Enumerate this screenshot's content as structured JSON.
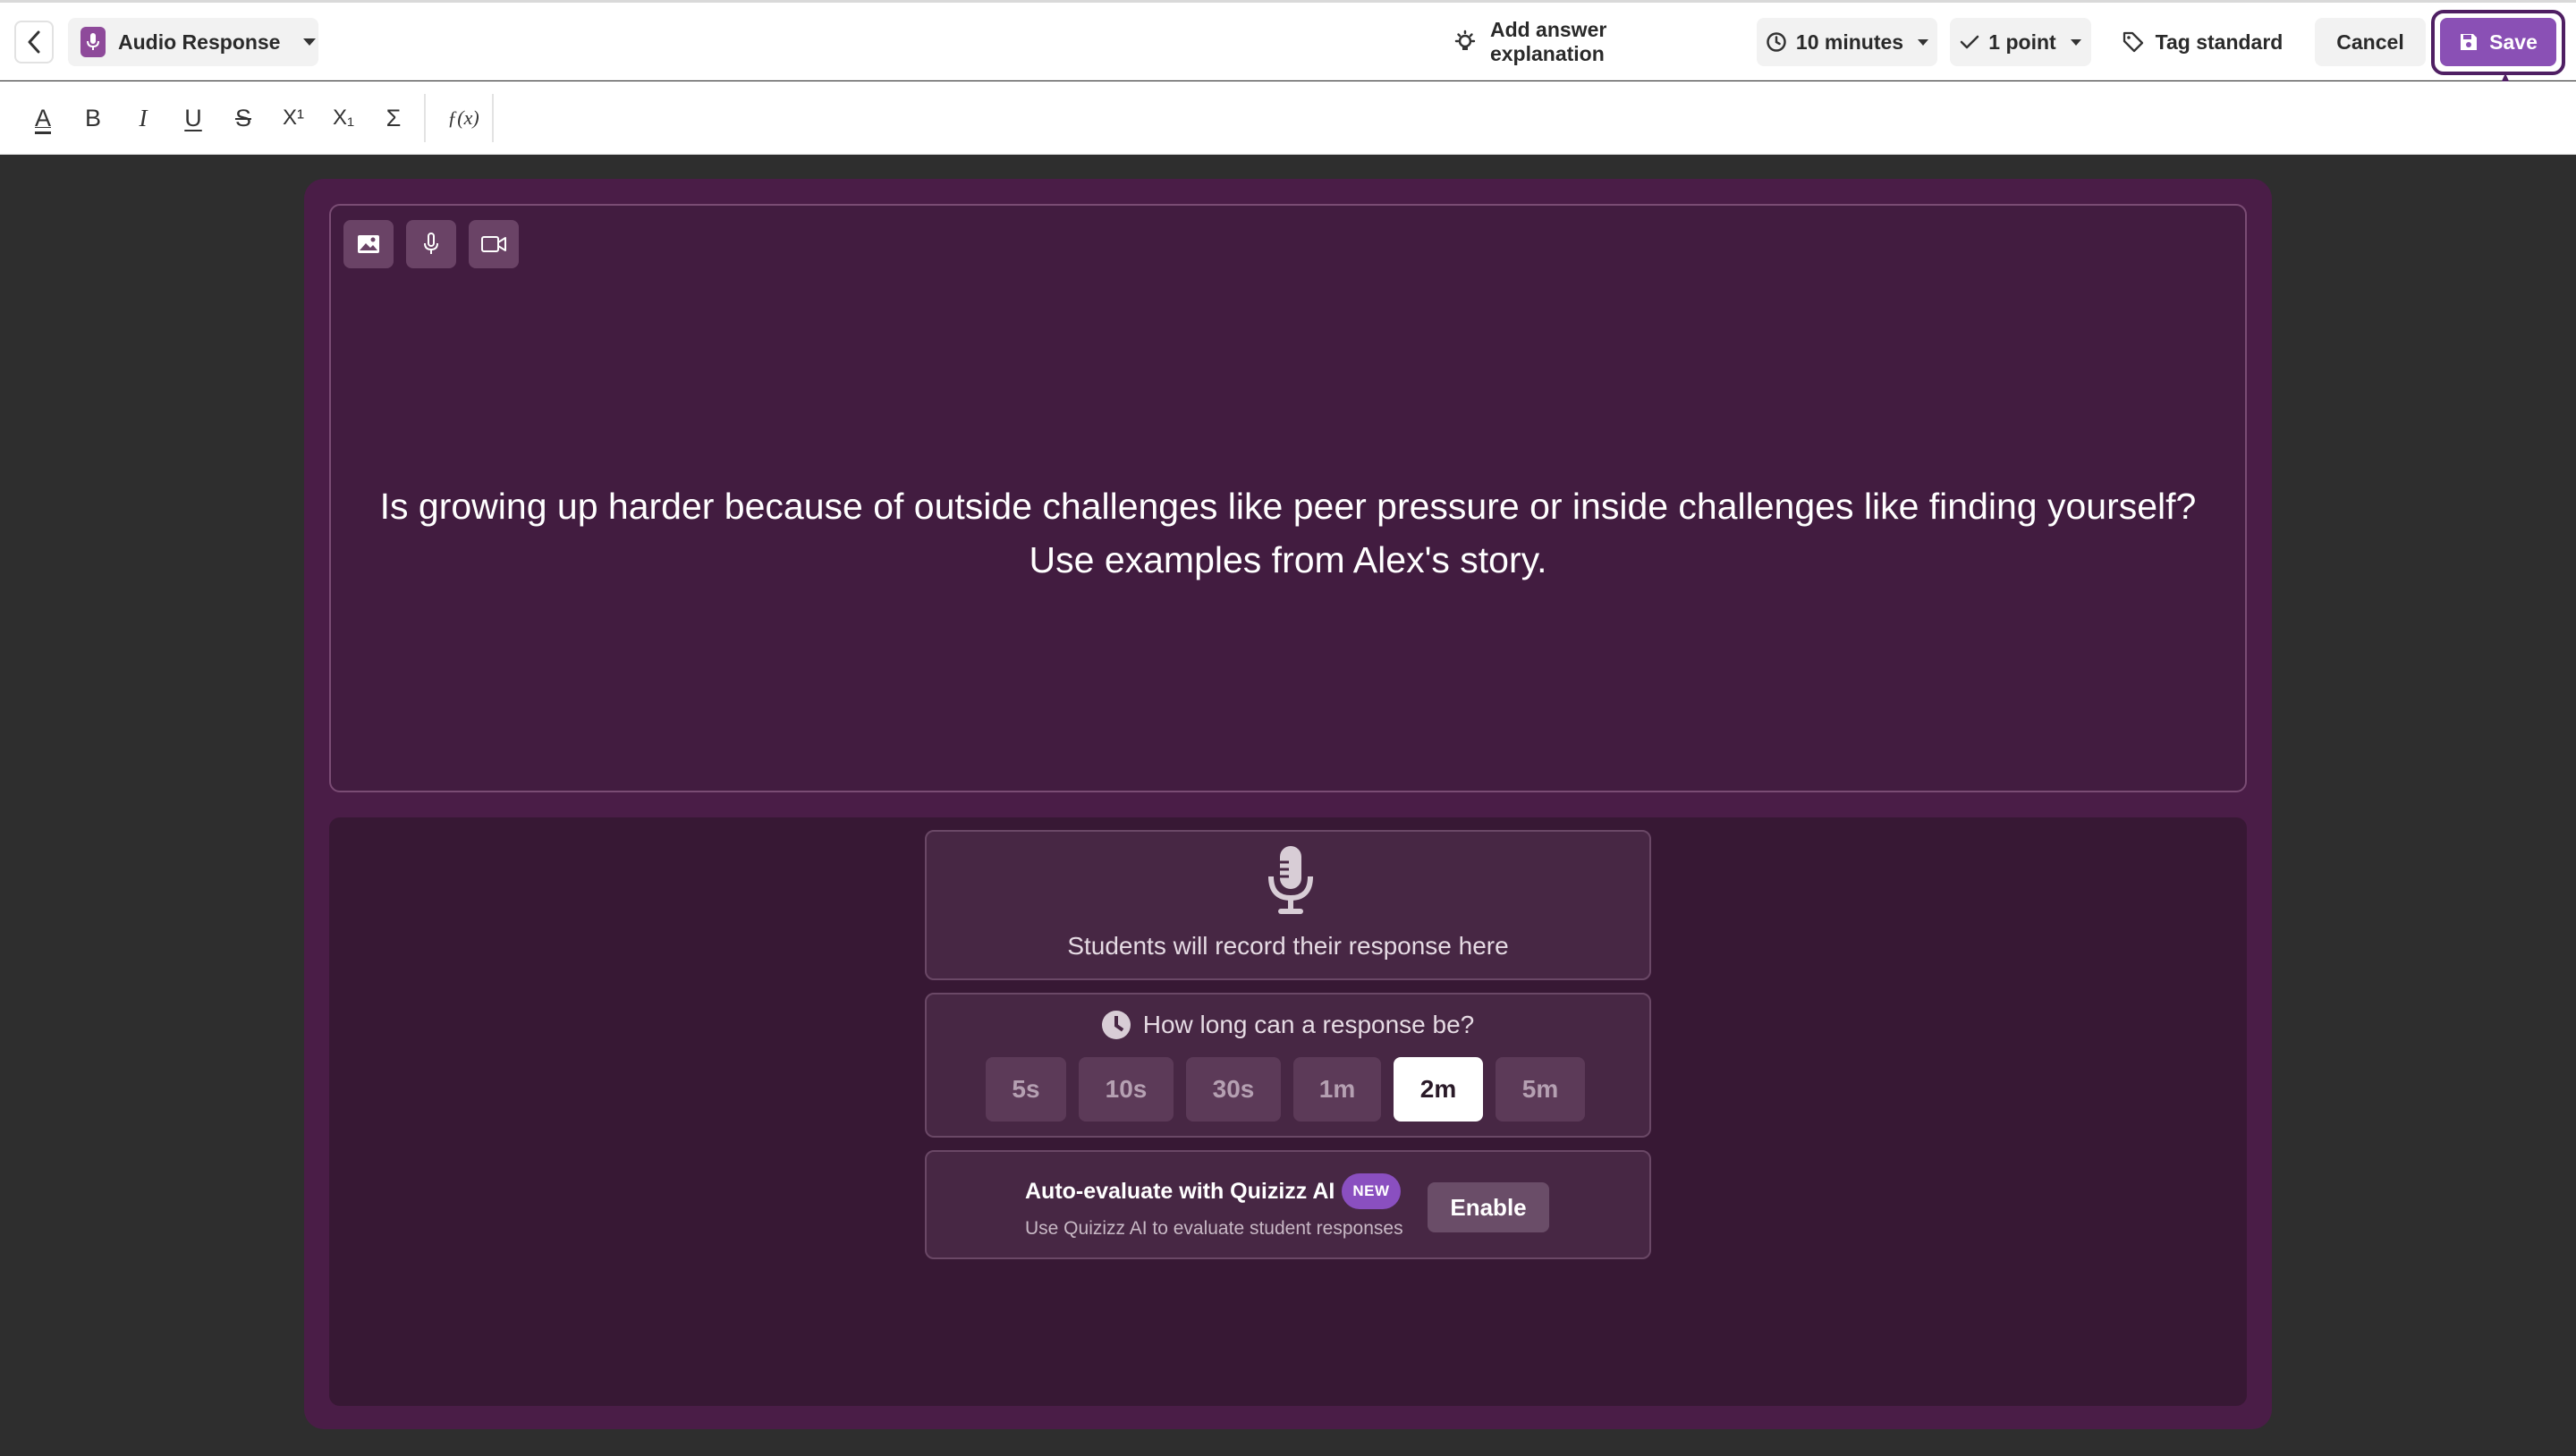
{
  "header": {
    "question_type": "Audio Response",
    "add_explanation": "Add answer explanation",
    "time_limit": "10 minutes",
    "points": "1 point",
    "tag_standard": "Tag standard",
    "cancel": "Cancel",
    "save": "Save"
  },
  "toolbar": {
    "text_color": "A",
    "bold": "B",
    "italic": "I",
    "underline": "U",
    "strikethrough": "S",
    "superscript": "X¹",
    "subscript": "X₁",
    "sigma": "Σ",
    "formula": "ƒ(x)"
  },
  "question": {
    "text": "Is growing up harder because of outside challenges like peer pressure or inside challenges like finding yourself? Use examples from Alex's story."
  },
  "answer": {
    "record_hint": "Students will record their response here",
    "duration_prompt": "How long can a response be?",
    "durations": [
      "5s",
      "10s",
      "30s",
      "1m",
      "2m",
      "5m"
    ],
    "selected_duration": "2m"
  },
  "ai": {
    "title": "Auto-evaluate with Quizizz AI",
    "badge": "NEW",
    "subtitle": "Use Quizizz AI to evaluate student responses",
    "enable": "Enable"
  },
  "colors": {
    "brand_purple": "#8a50b5",
    "editor_bg": "#4a1d47",
    "annotation": "#4f1f63"
  }
}
